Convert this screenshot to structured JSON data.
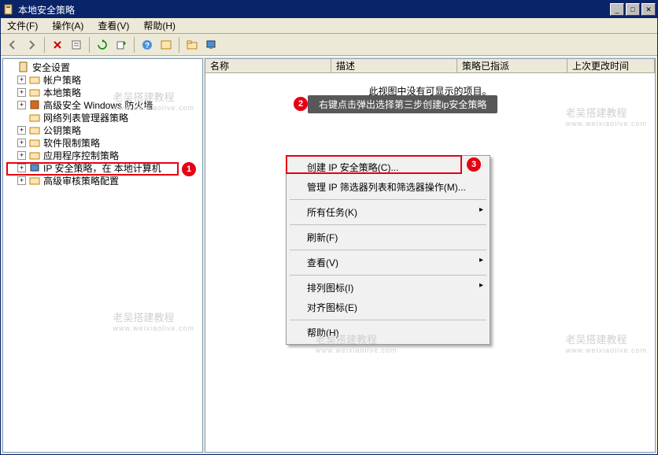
{
  "window": {
    "title": "本地安全策略"
  },
  "menubar": {
    "file": "文件(F)",
    "action": "操作(A)",
    "view": "查看(V)",
    "help": "帮助(H)"
  },
  "tree": {
    "root": "安全设置",
    "items": [
      {
        "label": "帐户策略",
        "expandable": true
      },
      {
        "label": "本地策略",
        "expandable": true
      },
      {
        "label": "高级安全 Windows 防火墙",
        "expandable": true
      },
      {
        "label": "网络列表管理器策略",
        "expandable": false
      },
      {
        "label": "公钥策略",
        "expandable": true
      },
      {
        "label": "软件限制策略",
        "expandable": true
      },
      {
        "label": "应用程序控制策略",
        "expandable": true
      },
      {
        "label": "IP 安全策略，在 本地计算机",
        "expandable": true,
        "selected": true
      },
      {
        "label": "高级审核策略配置",
        "expandable": true
      }
    ]
  },
  "list": {
    "columns": {
      "name": "名称",
      "desc": "描述",
      "assigned": "策略已指派",
      "modified": "上次更改时间"
    },
    "empty": "此视图中没有可显示的项目。"
  },
  "tooltip": "右键点击弹出选择第三步创建ip安全策略",
  "context_menu": {
    "create": "创建 IP 安全策略(C)...",
    "manage": "管理 IP 筛选器列表和筛选器操作(M)...",
    "all_tasks": "所有任务(K)",
    "refresh": "刷新(F)",
    "view": "查看(V)",
    "arrange": "排列图标(I)",
    "align": "对齐图标(E)",
    "help": "帮助(H)"
  },
  "badges": {
    "b1": "1",
    "b2": "2",
    "b3": "3"
  },
  "watermark": {
    "main": "老吴搭建教程",
    "sub": "www.weixiaolive.com"
  }
}
